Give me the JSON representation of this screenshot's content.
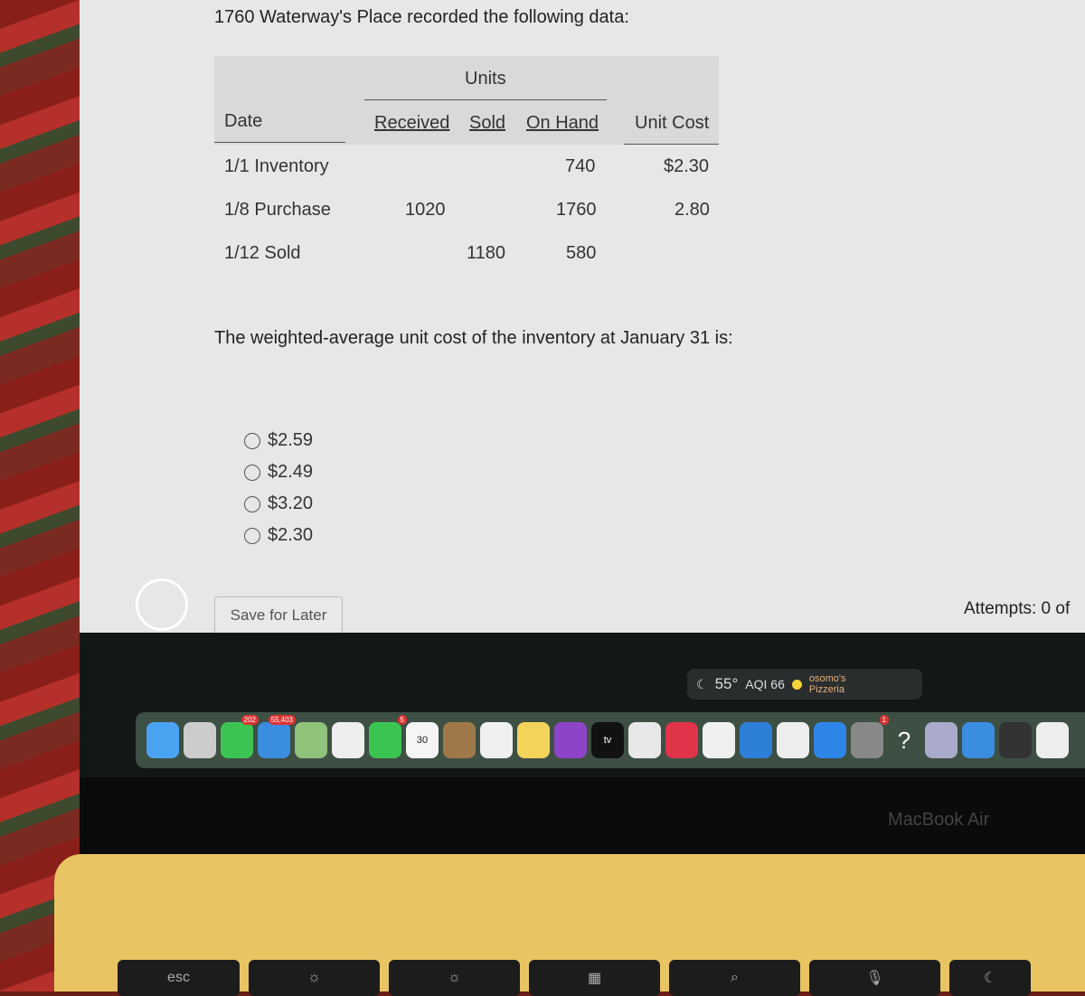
{
  "question": {
    "intro": "1760 Waterway's Place recorded the following data:",
    "prompt": "The weighted-average unit cost of the inventory at January 31 is:"
  },
  "table": {
    "group_header": "Units",
    "headers": [
      "Date",
      "Received",
      "Sold",
      "On Hand",
      "Unit Cost"
    ],
    "rows": [
      [
        "1/1 Inventory",
        "",
        "",
        "740",
        "$2.30"
      ],
      [
        "1/8 Purchase",
        "1020",
        "",
        "1760",
        "2.80"
      ],
      [
        "1/12 Sold",
        "",
        "1180",
        "580",
        ""
      ]
    ]
  },
  "options": [
    "$2.59",
    "$2.49",
    "$3.20",
    "$2.30"
  ],
  "save_label": "Save for Later",
  "attempts": "Attempts: 0 of",
  "widget": {
    "temp": "55°",
    "aqi": "AQI 66",
    "place": "osomo's Pizzeria"
  },
  "dock": [
    {
      "name": "finder",
      "color": "#4aa3f0"
    },
    {
      "name": "launchpad",
      "color": "#ccc"
    },
    {
      "name": "messages",
      "color": "#3cc452",
      "badge": "202"
    },
    {
      "name": "mail",
      "color": "#3b8de0",
      "badge": "55,403"
    },
    {
      "name": "maps",
      "color": "#8fc27a"
    },
    {
      "name": "photos",
      "color": "#eee"
    },
    {
      "name": "facetime",
      "color": "#3cc452",
      "badge": "5"
    },
    {
      "name": "calendar",
      "color": "#f5f5f5",
      "label": "30"
    },
    {
      "name": "contacts",
      "color": "#a0794a"
    },
    {
      "name": "reminders",
      "color": "#f0f0f0"
    },
    {
      "name": "notes",
      "color": "#f3d35a"
    },
    {
      "name": "podcasts",
      "color": "#8e44c9"
    },
    {
      "name": "apple-tv",
      "color": "#111",
      "label": "tv"
    },
    {
      "name": "numbers",
      "color": "#e8e8e8"
    },
    {
      "name": "music",
      "color": "#e0344a"
    },
    {
      "name": "news",
      "color": "#f0f0f0"
    },
    {
      "name": "keynote",
      "color": "#2e7fd8"
    },
    {
      "name": "pages",
      "color": "#eee"
    },
    {
      "name": "app-store",
      "color": "#2e86e8"
    },
    {
      "name": "system-settings",
      "color": "#888",
      "badge": "1"
    },
    {
      "name": "help",
      "color": "transparent",
      "label": "?"
    },
    {
      "name": "preview",
      "color": "#aac"
    },
    {
      "name": "safari",
      "color": "#3b8de0"
    },
    {
      "name": "calculator",
      "color": "#333"
    },
    {
      "name": "chrome",
      "color": "#eee"
    }
  ],
  "brand": "MacBook Air",
  "keys": [
    "esc",
    "",
    "",
    "",
    "",
    "",
    "",
    "",
    ""
  ]
}
